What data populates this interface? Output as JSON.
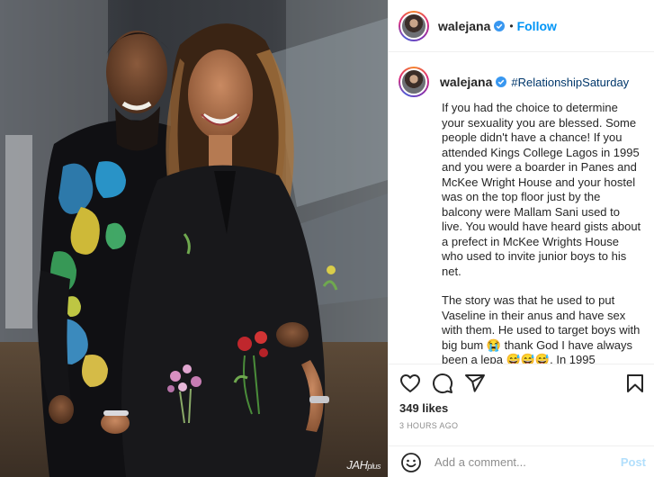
{
  "post": {
    "username": "walejana",
    "follow_label": "Follow",
    "separator": "•",
    "hashtag": "#RelationshipSaturday",
    "caption_paragraphs": [
      "If you had the choice to determine your sexuality you are blessed. Some people didn't have a chance! If you attended Kings College Lagos in 1995 and you were a boarder in Panes and McKee Wright House and your hostel was on the top floor just by the balcony were Mallam Sani used to live. You would have heard gists about a prefect in McKee Wrights House who used to invite junior boys to his net.",
      "The story was that he used to put Vaseline in their anus and have sex with them. He used to target boys with big bum 😭 thank God I have always been a lepa 😅😅😅. In 1995"
    ],
    "likes": "349 likes",
    "time": "3 HOURS AGO"
  },
  "photo": {
    "watermark": "JAH",
    "watermark_suffix": "plus"
  },
  "comment": {
    "placeholder": "Add a comment...",
    "post_label": "Post"
  },
  "colors": {
    "accent": "#0095f6",
    "hashtag": "#00376b",
    "post_disabled": "#b2dffc",
    "muted": "#8e8e8e"
  },
  "icons": [
    "verified-badge-icon",
    "heart-icon",
    "comment-icon",
    "share-icon",
    "bookmark-icon",
    "emoji-icon"
  ]
}
